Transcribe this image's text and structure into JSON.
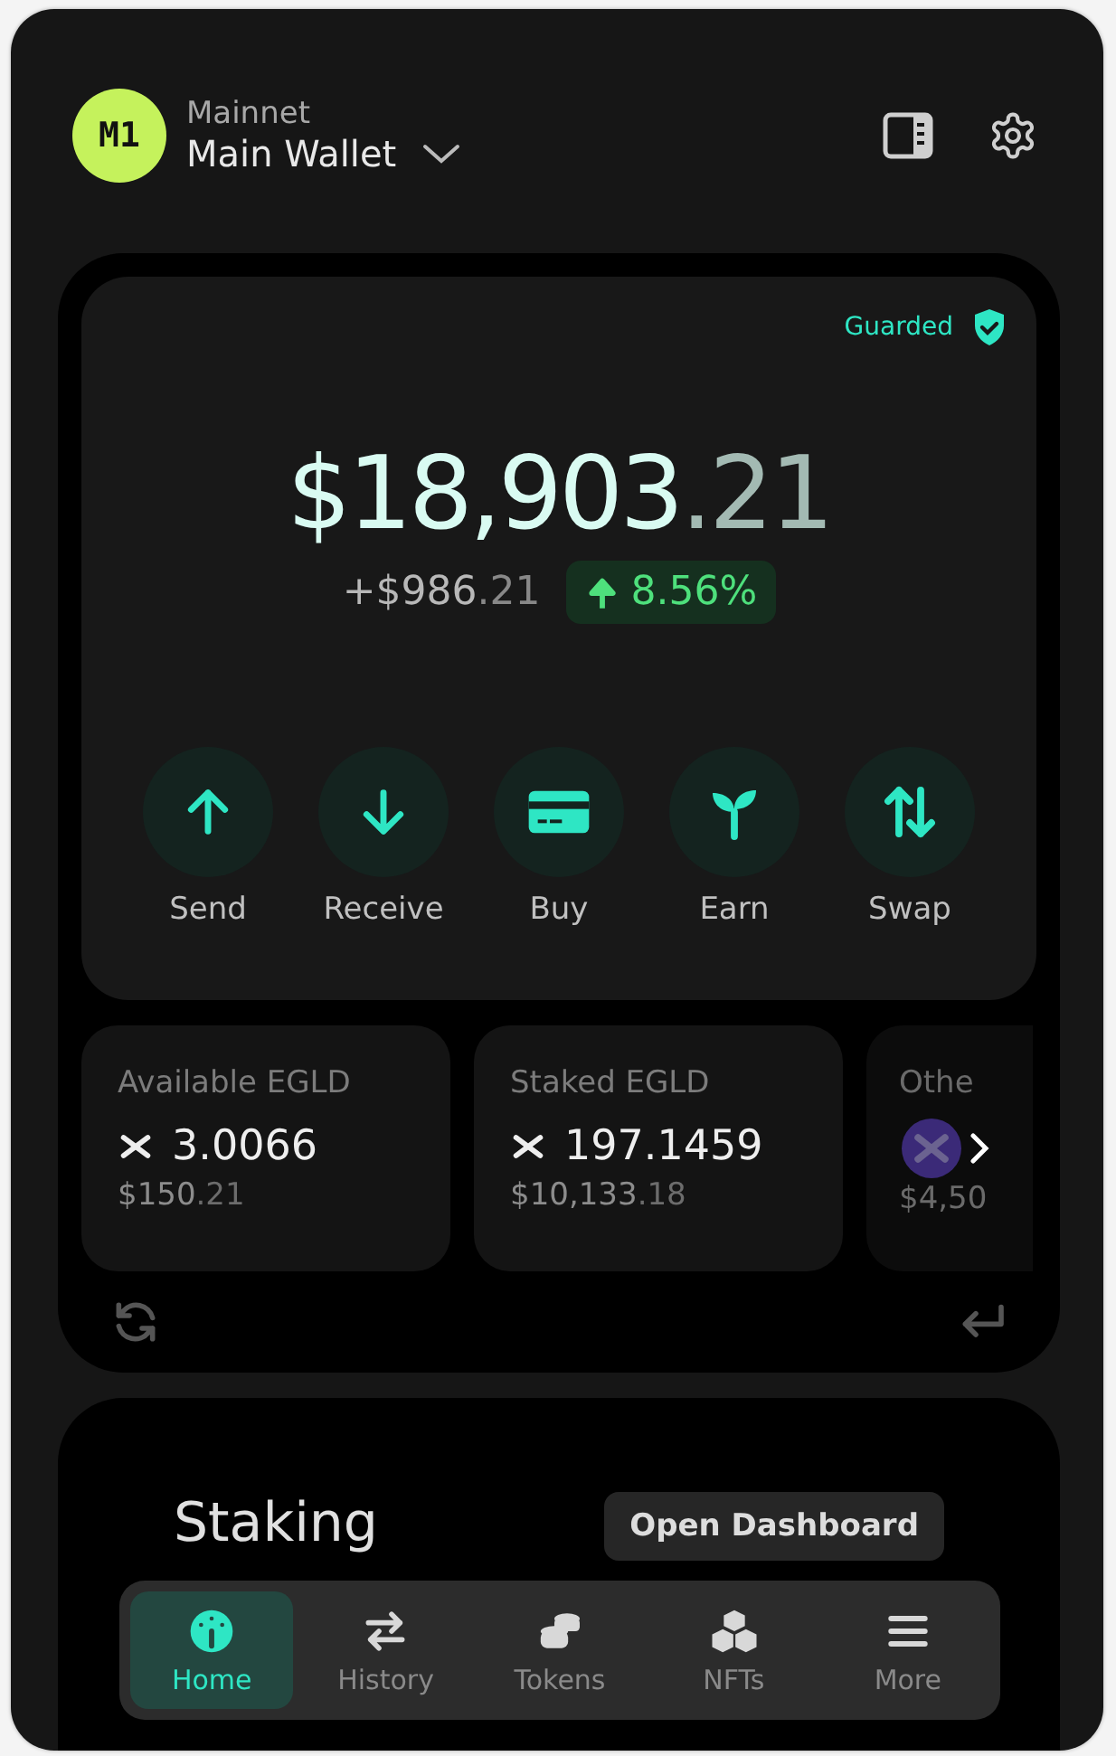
{
  "header": {
    "avatar": "M1",
    "network": "Mainnet",
    "wallet": "Main Wallet"
  },
  "balance": {
    "badge": "Guarded",
    "whole": "$18,903",
    "cents": ".21",
    "change_whole": "+$986",
    "change_cents": ".21",
    "change_pct": "8.56%"
  },
  "actions": [
    {
      "kind": "send",
      "label": "Send"
    },
    {
      "kind": "receive",
      "label": "Receive"
    },
    {
      "kind": "buy",
      "label": "Buy"
    },
    {
      "kind": "earn",
      "label": "Earn"
    },
    {
      "kind": "swap",
      "label": "Swap"
    }
  ],
  "assets": [
    {
      "kind": "full",
      "title": "Available EGLD",
      "amount": "3.0066",
      "value_whole": "$150",
      "value_cents": ".21"
    },
    {
      "kind": "full",
      "title": "Staked EGLD",
      "amount": "197.1459",
      "value_whole": "$10,133",
      "value_cents": ".18"
    },
    {
      "kind": "faded",
      "title": "Othe",
      "value_whole": "$4,50"
    }
  ],
  "staking": {
    "title": "Staking",
    "button": "Open Dashboard"
  },
  "nav": [
    {
      "kind": "home",
      "label": "Home",
      "selected": true
    },
    {
      "kind": "history",
      "label": "History",
      "selected": false
    },
    {
      "kind": "tokens",
      "label": "Tokens",
      "selected": false
    },
    {
      "kind": "nfts",
      "label": "NFTs",
      "selected": false
    },
    {
      "kind": "more",
      "label": "More",
      "selected": false
    }
  ]
}
